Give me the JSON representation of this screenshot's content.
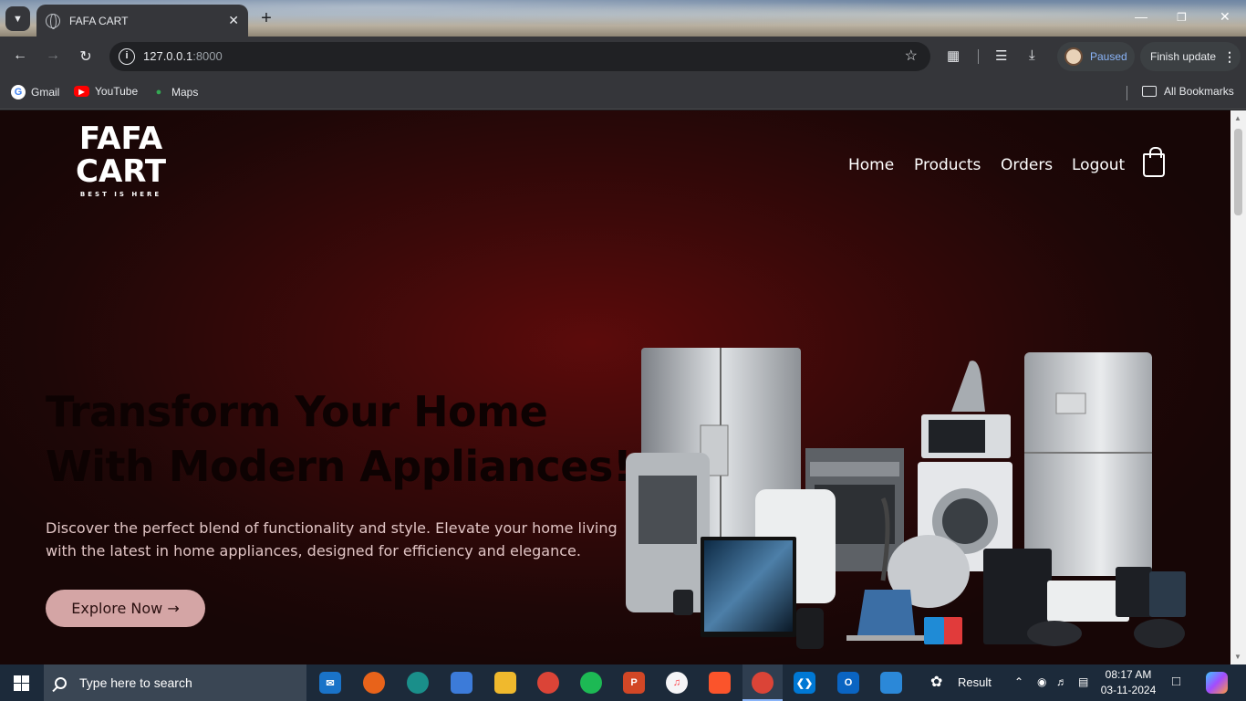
{
  "tab": {
    "title": "FAFA CART"
  },
  "address": {
    "host": "127.0.0.1",
    "port": ":8000"
  },
  "profile": {
    "status": "Paused"
  },
  "update_button": "Finish update",
  "bookmarks": [
    {
      "label": "Gmail",
      "icon": "gmail-icon"
    },
    {
      "label": "YouTube",
      "icon": "youtube-icon"
    },
    {
      "label": "Maps",
      "icon": "maps-icon"
    }
  ],
  "all_bookmarks": "All Bookmarks",
  "site": {
    "logo": {
      "line1": "FAFA",
      "line2": "CART",
      "tagline": "BEST IS HERE"
    },
    "nav": [
      "Home",
      "Products",
      "Orders",
      "Logout"
    ],
    "hero": {
      "title_line1": "Transform Your Home",
      "title_line2": "With Modern Appliances!",
      "description": "Discover the perfect blend of functionality and style. Elevate your home living with the latest in home appliances, designed for efficiency and elegance.",
      "cta": "Explore Now →"
    }
  },
  "taskbar": {
    "search_placeholder": "Type here to search",
    "weather_label": "Result",
    "time": "08:17 AM",
    "date": "03-11-2024"
  },
  "colors": {
    "accent": "#d4a5a5",
    "hero_bg": "#5c0b0b",
    "title": "#0d0202"
  }
}
